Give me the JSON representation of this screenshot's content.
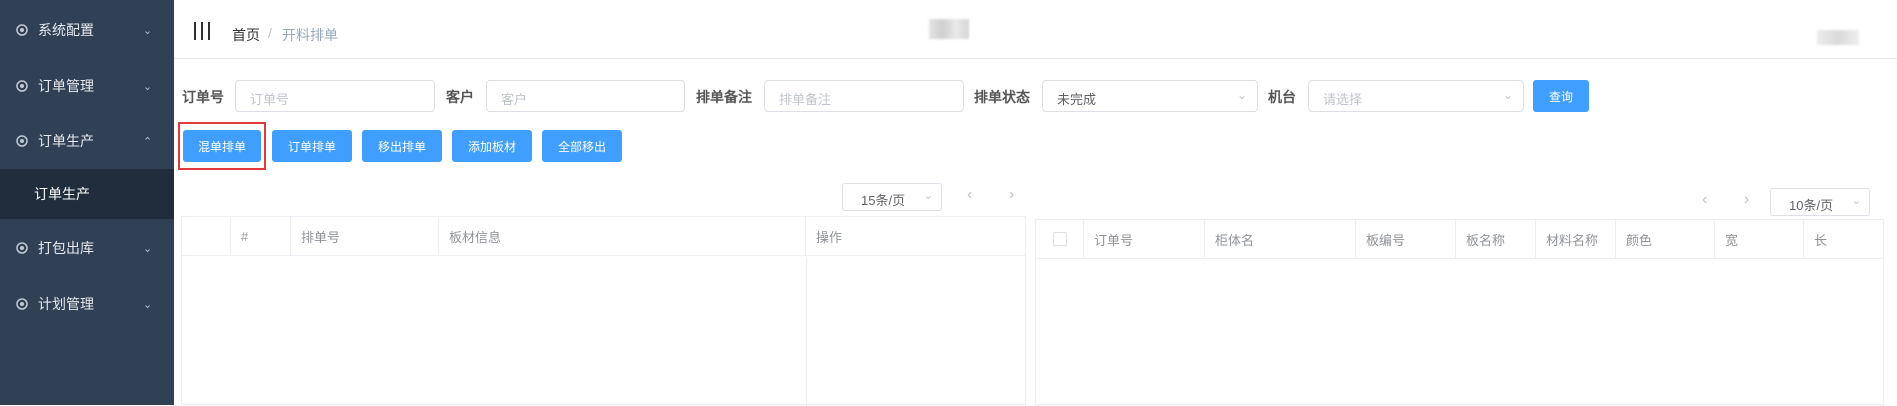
{
  "sidebar": {
    "items": [
      {
        "label": "系统配置",
        "icon": "gear-icon",
        "chevron": "chevron-down"
      },
      {
        "label": "订单管理",
        "icon": "gear-icon",
        "chevron": "chevron-down"
      },
      {
        "label": "订单生产",
        "icon": "gear-icon",
        "chevron": "chevron-up",
        "expanded": true
      },
      {
        "label": "打包出库",
        "icon": "gear-icon",
        "chevron": "chevron-down"
      },
      {
        "label": "计划管理",
        "icon": "gear-icon",
        "chevron": "chevron-down"
      }
    ],
    "subitem": {
      "label": "订单生产"
    },
    "bg_color": "#304156",
    "active_bg_color": "#1f2d3d"
  },
  "navbar": {
    "breadcrumb": {
      "home": "首页",
      "separator": "/",
      "current": "开料排单"
    }
  },
  "filters": {
    "order_no": {
      "label": "订单号",
      "placeholder": "订单号"
    },
    "customer": {
      "label": "客户",
      "placeholder": "客户"
    },
    "schedule_note": {
      "label": "排单备注",
      "placeholder": "排单备注"
    },
    "schedule_status": {
      "label": "排单状态",
      "value": "未完成"
    },
    "machine": {
      "label": "机台",
      "placeholder": "请选择"
    },
    "query_button": "查询"
  },
  "actions": {
    "mixed_schedule": "混单排单",
    "order_schedule": "订单排单",
    "remove_schedule": "移出排单",
    "add_board": "添加板材",
    "remove_all": "全部移出"
  },
  "left_table": {
    "page_size": "15条/页",
    "prev": "‹",
    "next": "›",
    "columns": [
      "#",
      "排单号",
      "板材信息"
    ],
    "op_column": "操作"
  },
  "right_table": {
    "page_size": "10条/页",
    "prev": "‹",
    "next": "›",
    "columns": [
      "订单号",
      "柜体名",
      "板编号",
      "板名称",
      "材料名称",
      "颜色",
      "宽",
      "长"
    ]
  },
  "colors": {
    "primary": "#409eff",
    "highlight": "#e03a3a"
  }
}
